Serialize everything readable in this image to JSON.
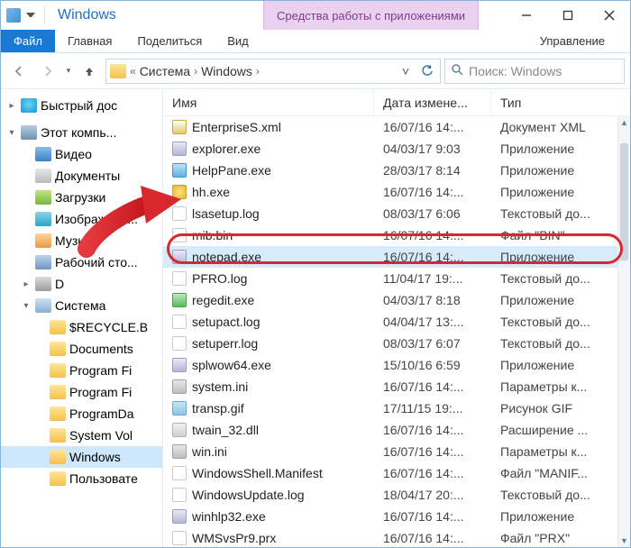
{
  "title": "Windows",
  "context_tab": "Средства работы с приложениями",
  "ribbon": {
    "file": "Файл",
    "home": "Главная",
    "share": "Поделиться",
    "view": "Вид",
    "manage": "Управление"
  },
  "breadcrumb": {
    "level1": "Система",
    "level2": "Windows"
  },
  "search_placeholder": "Поиск: Windows",
  "columns": {
    "name": "Имя",
    "date": "Дата измене...",
    "type": "Тип"
  },
  "sidebar": {
    "quick": "Быстрый дос",
    "pc": "Этот компь...",
    "items": [
      {
        "label": "Видео",
        "ico": "ico-video"
      },
      {
        "label": "Документы",
        "ico": "ico-doc"
      },
      {
        "label": "Загрузки",
        "ico": "ico-dl"
      },
      {
        "label": "Изображени...",
        "ico": "ico-img"
      },
      {
        "label": "Музыка",
        "ico": "ico-music"
      },
      {
        "label": "Рабочий сто...",
        "ico": "ico-desk"
      },
      {
        "label": "D",
        "ico": "ico-drive"
      },
      {
        "label": "Система",
        "ico": "ico-sys",
        "expanded": true
      }
    ],
    "sysitems": [
      "$RECYCLE.B",
      "Documents",
      "Program Fi",
      "Program Fi",
      "ProgramDa",
      "System Vol",
      "Windows",
      "Пользовате"
    ]
  },
  "files": [
    {
      "name": "EnterpriseS.xml",
      "date": "16/07/16 14:...",
      "type": "Документ XML",
      "ico": "fico-xml"
    },
    {
      "name": "explorer.exe",
      "date": "04/03/17 9:03",
      "type": "Приложение",
      "ico": "fico-exe"
    },
    {
      "name": "HelpPane.exe",
      "date": "28/03/17 8:14",
      "type": "Приложение",
      "ico": "fico-help"
    },
    {
      "name": "hh.exe",
      "date": "16/07/16 14:...",
      "type": "Приложение",
      "ico": "fico-hh"
    },
    {
      "name": "lsasetup.log",
      "date": "08/03/17 6:06",
      "type": "Текстовый до...",
      "ico": "fico-log"
    },
    {
      "name": "mib.bin",
      "date": "16/07/16 14:...",
      "type": "Файл \"BIN\"",
      "ico": "fico-bin"
    },
    {
      "name": "notepad.exe",
      "date": "16/07/16 14:...",
      "type": "Приложение",
      "ico": "fico-exe",
      "selected": true
    },
    {
      "name": "PFRO.log",
      "date": "11/04/17 19:...",
      "type": "Текстовый до...",
      "ico": "fico-log"
    },
    {
      "name": "regedit.exe",
      "date": "04/03/17 8:18",
      "type": "Приложение",
      "ico": "fico-regedit"
    },
    {
      "name": "setupact.log",
      "date": "04/04/17 13:...",
      "type": "Текстовый до...",
      "ico": "fico-log"
    },
    {
      "name": "setuperr.log",
      "date": "08/03/17 6:07",
      "type": "Текстовый до...",
      "ico": "fico-log"
    },
    {
      "name": "splwow64.exe",
      "date": "15/10/16 6:59",
      "type": "Приложение",
      "ico": "fico-exe"
    },
    {
      "name": "system.ini",
      "date": "16/07/16 14:...",
      "type": "Параметры к...",
      "ico": "fico-ini"
    },
    {
      "name": "transp.gif",
      "date": "17/11/15 19:...",
      "type": "Рисунок GIF",
      "ico": "fico-gif"
    },
    {
      "name": "twain_32.dll",
      "date": "16/07/16 14:...",
      "type": "Расширение ...",
      "ico": "fico-dll"
    },
    {
      "name": "win.ini",
      "date": "16/07/16 14:...",
      "type": "Параметры к...",
      "ico": "fico-ini"
    },
    {
      "name": "WindowsShell.Manifest",
      "date": "16/07/16 14:...",
      "type": "Файл \"MANIF...",
      "ico": "fico-manifest"
    },
    {
      "name": "WindowsUpdate.log",
      "date": "18/04/17 20:...",
      "type": "Текстовый до...",
      "ico": "fico-log"
    },
    {
      "name": "winhlp32.exe",
      "date": "16/07/16 14:...",
      "type": "Приложение",
      "ico": "fico-exe"
    },
    {
      "name": "WMSvsPr9.prx",
      "date": "16/07/16 14:...",
      "type": "Файл \"PRX\"",
      "ico": "fico-prx"
    }
  ]
}
